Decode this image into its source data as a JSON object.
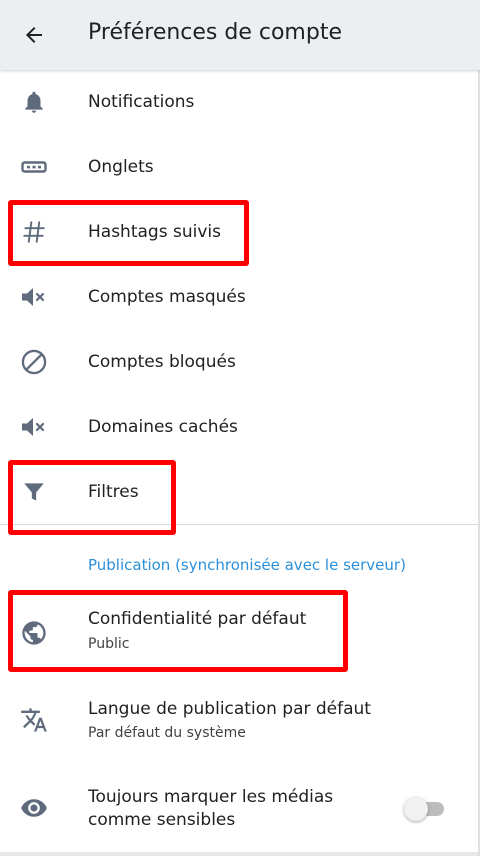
{
  "app_bar": {
    "back_icon": "arrow-left-icon",
    "title": "Préférences de compte"
  },
  "items": [
    {
      "icon": "bell-icon",
      "label": "Notifications"
    },
    {
      "icon": "tabs-icon",
      "label": "Onglets"
    },
    {
      "icon": "hashtag-icon",
      "label": "Hashtags suivis",
      "highlighted": true
    },
    {
      "icon": "volume-off-icon",
      "label": "Comptes masqués"
    },
    {
      "icon": "block-icon",
      "label": "Comptes bloqués"
    },
    {
      "icon": "volume-off-icon",
      "label": "Domaines cachés"
    },
    {
      "icon": "filter-icon",
      "label": "Filtres",
      "highlighted": true
    }
  ],
  "publishing_section": {
    "header": "Publication (synchronisée avec le serveur)",
    "items": [
      {
        "icon": "globe-icon",
        "label": "Confidentialité par défaut",
        "value": "Public",
        "highlighted": true
      },
      {
        "icon": "translate-icon",
        "label": "Langue de publication par défaut",
        "value": "Par défaut du système"
      },
      {
        "icon": "eye-icon",
        "label_line1": "Toujours marquer les médias",
        "label_line2": "comme sensibles",
        "toggle_on": false
      }
    ]
  },
  "colors": {
    "app_bar_bg": "#eceff1",
    "icon": "#5f6b7d",
    "accent": "#2b90d9",
    "highlight": "#ff0000"
  }
}
